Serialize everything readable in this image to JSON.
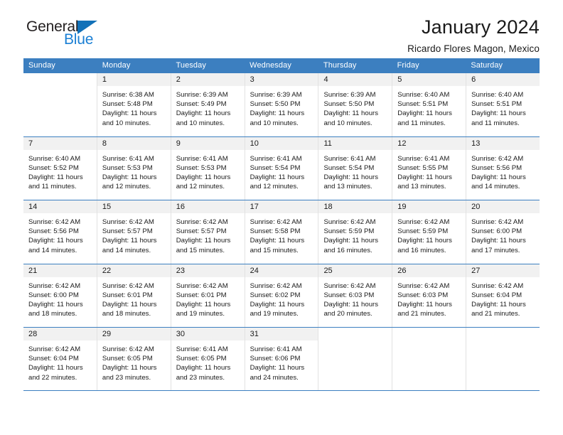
{
  "brand": {
    "name_part1": "General",
    "name_part2": "Blue",
    "accent_color": "#1a7fd4",
    "triangle_color": "#1271b8"
  },
  "header": {
    "title": "January 2024",
    "subtitle": "Ricardo Flores Magon, Mexico"
  },
  "calendar": {
    "header_background": "#3c7fc0",
    "weekday_headers": [
      "Sunday",
      "Monday",
      "Tuesday",
      "Wednesday",
      "Thursday",
      "Friday",
      "Saturday"
    ],
    "weeks": [
      [
        {
          "day": "",
          "lines": []
        },
        {
          "day": "1",
          "lines": [
            "Sunrise: 6:38 AM",
            "Sunset: 5:48 PM",
            "Daylight: 11 hours",
            "and 10 minutes."
          ]
        },
        {
          "day": "2",
          "lines": [
            "Sunrise: 6:39 AM",
            "Sunset: 5:49 PM",
            "Daylight: 11 hours",
            "and 10 minutes."
          ]
        },
        {
          "day": "3",
          "lines": [
            "Sunrise: 6:39 AM",
            "Sunset: 5:50 PM",
            "Daylight: 11 hours",
            "and 10 minutes."
          ]
        },
        {
          "day": "4",
          "lines": [
            "Sunrise: 6:39 AM",
            "Sunset: 5:50 PM",
            "Daylight: 11 hours",
            "and 10 minutes."
          ]
        },
        {
          "day": "5",
          "lines": [
            "Sunrise: 6:40 AM",
            "Sunset: 5:51 PM",
            "Daylight: 11 hours",
            "and 11 minutes."
          ]
        },
        {
          "day": "6",
          "lines": [
            "Sunrise: 6:40 AM",
            "Sunset: 5:51 PM",
            "Daylight: 11 hours",
            "and 11 minutes."
          ]
        }
      ],
      [
        {
          "day": "7",
          "lines": [
            "Sunrise: 6:40 AM",
            "Sunset: 5:52 PM",
            "Daylight: 11 hours",
            "and 11 minutes."
          ]
        },
        {
          "day": "8",
          "lines": [
            "Sunrise: 6:41 AM",
            "Sunset: 5:53 PM",
            "Daylight: 11 hours",
            "and 12 minutes."
          ]
        },
        {
          "day": "9",
          "lines": [
            "Sunrise: 6:41 AM",
            "Sunset: 5:53 PM",
            "Daylight: 11 hours",
            "and 12 minutes."
          ]
        },
        {
          "day": "10",
          "lines": [
            "Sunrise: 6:41 AM",
            "Sunset: 5:54 PM",
            "Daylight: 11 hours",
            "and 12 minutes."
          ]
        },
        {
          "day": "11",
          "lines": [
            "Sunrise: 6:41 AM",
            "Sunset: 5:54 PM",
            "Daylight: 11 hours",
            "and 13 minutes."
          ]
        },
        {
          "day": "12",
          "lines": [
            "Sunrise: 6:41 AM",
            "Sunset: 5:55 PM",
            "Daylight: 11 hours",
            "and 13 minutes."
          ]
        },
        {
          "day": "13",
          "lines": [
            "Sunrise: 6:42 AM",
            "Sunset: 5:56 PM",
            "Daylight: 11 hours",
            "and 14 minutes."
          ]
        }
      ],
      [
        {
          "day": "14",
          "lines": [
            "Sunrise: 6:42 AM",
            "Sunset: 5:56 PM",
            "Daylight: 11 hours",
            "and 14 minutes."
          ]
        },
        {
          "day": "15",
          "lines": [
            "Sunrise: 6:42 AM",
            "Sunset: 5:57 PM",
            "Daylight: 11 hours",
            "and 14 minutes."
          ]
        },
        {
          "day": "16",
          "lines": [
            "Sunrise: 6:42 AM",
            "Sunset: 5:57 PM",
            "Daylight: 11 hours",
            "and 15 minutes."
          ]
        },
        {
          "day": "17",
          "lines": [
            "Sunrise: 6:42 AM",
            "Sunset: 5:58 PM",
            "Daylight: 11 hours",
            "and 15 minutes."
          ]
        },
        {
          "day": "18",
          "lines": [
            "Sunrise: 6:42 AM",
            "Sunset: 5:59 PM",
            "Daylight: 11 hours",
            "and 16 minutes."
          ]
        },
        {
          "day": "19",
          "lines": [
            "Sunrise: 6:42 AM",
            "Sunset: 5:59 PM",
            "Daylight: 11 hours",
            "and 16 minutes."
          ]
        },
        {
          "day": "20",
          "lines": [
            "Sunrise: 6:42 AM",
            "Sunset: 6:00 PM",
            "Daylight: 11 hours",
            "and 17 minutes."
          ]
        }
      ],
      [
        {
          "day": "21",
          "lines": [
            "Sunrise: 6:42 AM",
            "Sunset: 6:00 PM",
            "Daylight: 11 hours",
            "and 18 minutes."
          ]
        },
        {
          "day": "22",
          "lines": [
            "Sunrise: 6:42 AM",
            "Sunset: 6:01 PM",
            "Daylight: 11 hours",
            "and 18 minutes."
          ]
        },
        {
          "day": "23",
          "lines": [
            "Sunrise: 6:42 AM",
            "Sunset: 6:01 PM",
            "Daylight: 11 hours",
            "and 19 minutes."
          ]
        },
        {
          "day": "24",
          "lines": [
            "Sunrise: 6:42 AM",
            "Sunset: 6:02 PM",
            "Daylight: 11 hours",
            "and 19 minutes."
          ]
        },
        {
          "day": "25",
          "lines": [
            "Sunrise: 6:42 AM",
            "Sunset: 6:03 PM",
            "Daylight: 11 hours",
            "and 20 minutes."
          ]
        },
        {
          "day": "26",
          "lines": [
            "Sunrise: 6:42 AM",
            "Sunset: 6:03 PM",
            "Daylight: 11 hours",
            "and 21 minutes."
          ]
        },
        {
          "day": "27",
          "lines": [
            "Sunrise: 6:42 AM",
            "Sunset: 6:04 PM",
            "Daylight: 11 hours",
            "and 21 minutes."
          ]
        }
      ],
      [
        {
          "day": "28",
          "lines": [
            "Sunrise: 6:42 AM",
            "Sunset: 6:04 PM",
            "Daylight: 11 hours",
            "and 22 minutes."
          ]
        },
        {
          "day": "29",
          "lines": [
            "Sunrise: 6:42 AM",
            "Sunset: 6:05 PM",
            "Daylight: 11 hours",
            "and 23 minutes."
          ]
        },
        {
          "day": "30",
          "lines": [
            "Sunrise: 6:41 AM",
            "Sunset: 6:05 PM",
            "Daylight: 11 hours",
            "and 23 minutes."
          ]
        },
        {
          "day": "31",
          "lines": [
            "Sunrise: 6:41 AM",
            "Sunset: 6:06 PM",
            "Daylight: 11 hours",
            "and 24 minutes."
          ]
        },
        {
          "day": "",
          "lines": []
        },
        {
          "day": "",
          "lines": []
        },
        {
          "day": "",
          "lines": []
        }
      ]
    ]
  }
}
